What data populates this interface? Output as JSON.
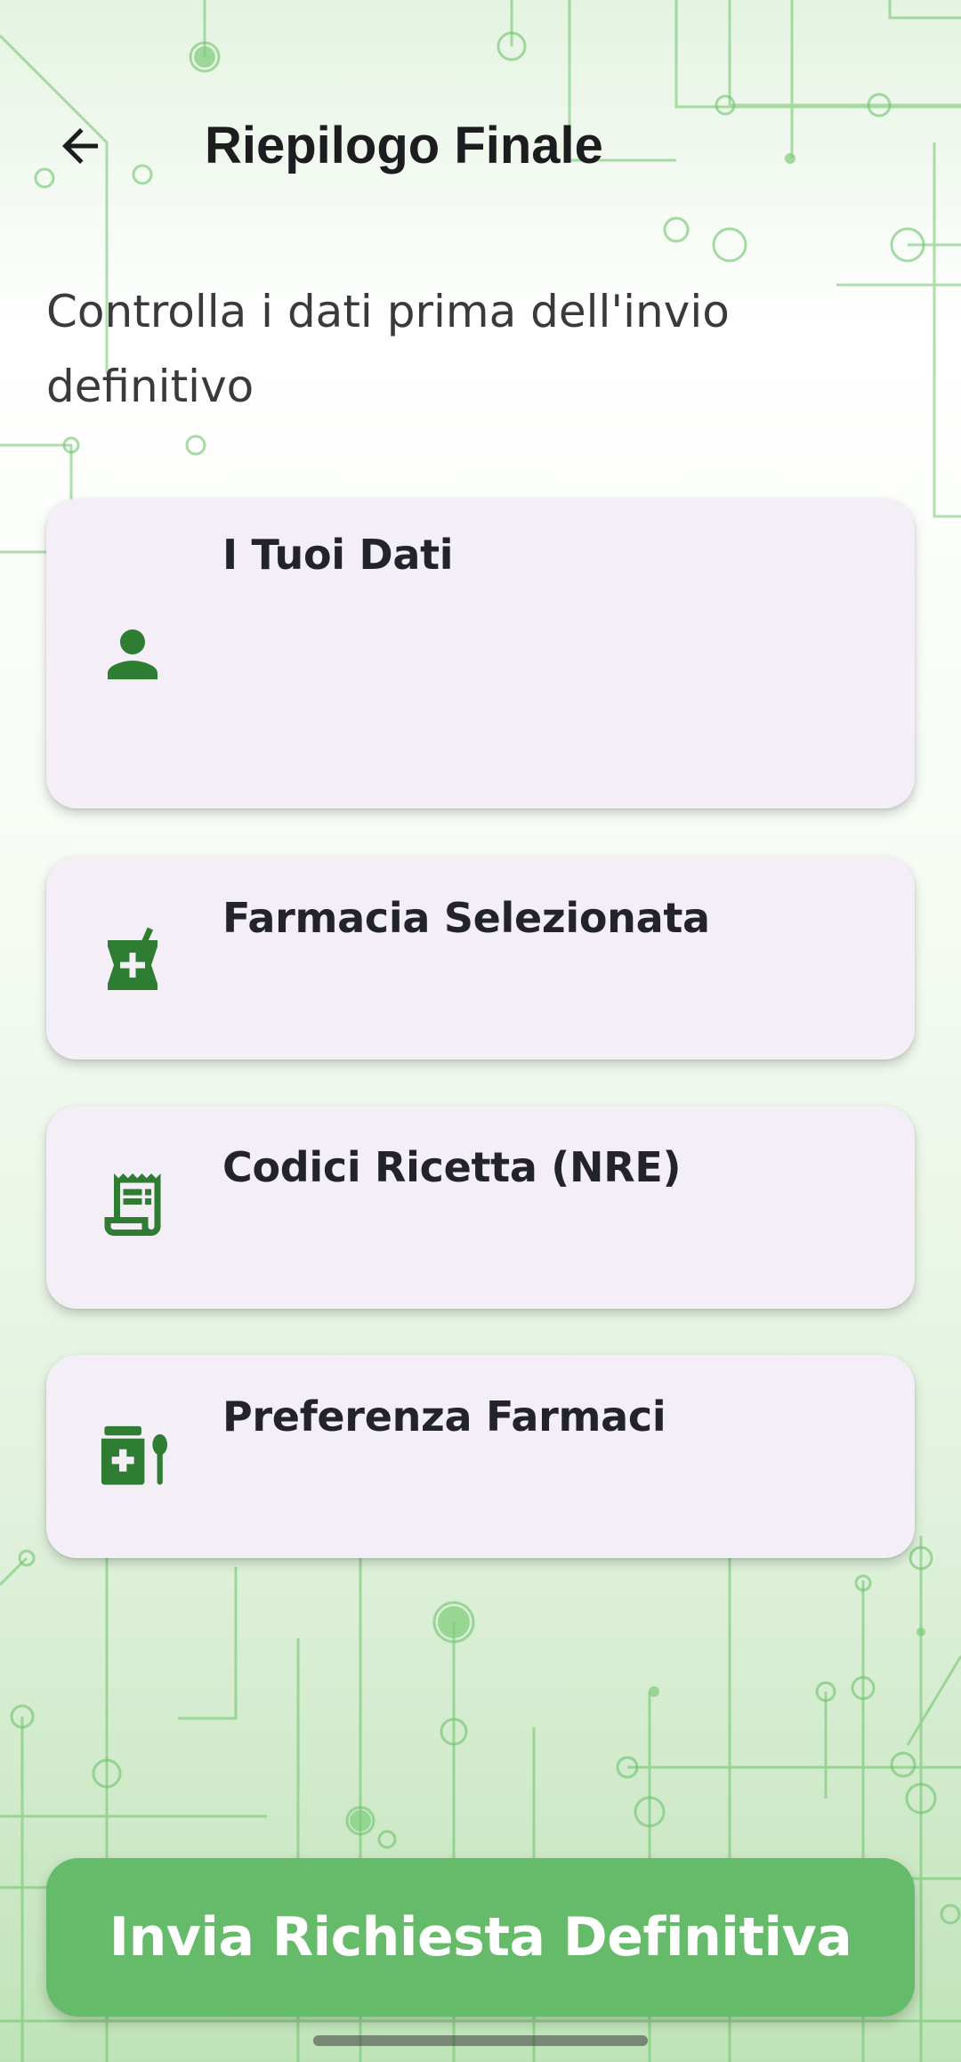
{
  "header": {
    "back_icon": "arrow-left-icon",
    "title": "Riepilogo Finale"
  },
  "subtitle": "Controlla i dati prima dell'invio definitivo",
  "cards": [
    {
      "title": "I Tuoi Dati",
      "icon": "person-icon"
    },
    {
      "title": "Farmacia Selezionata",
      "icon": "pharmacy-mortar-icon"
    },
    {
      "title": "Codici Ricetta (NRE)",
      "icon": "receipt-icon"
    },
    {
      "title": "Preferenza Farmaci",
      "icon": "medication-icon"
    }
  ],
  "submit_button": {
    "label": "Invia Richiesta Definitiva"
  },
  "colors": {
    "accent": "#2e7d32",
    "button": "#66bb6a",
    "card": "#f4eff7",
    "circuit": "#4caf50"
  }
}
